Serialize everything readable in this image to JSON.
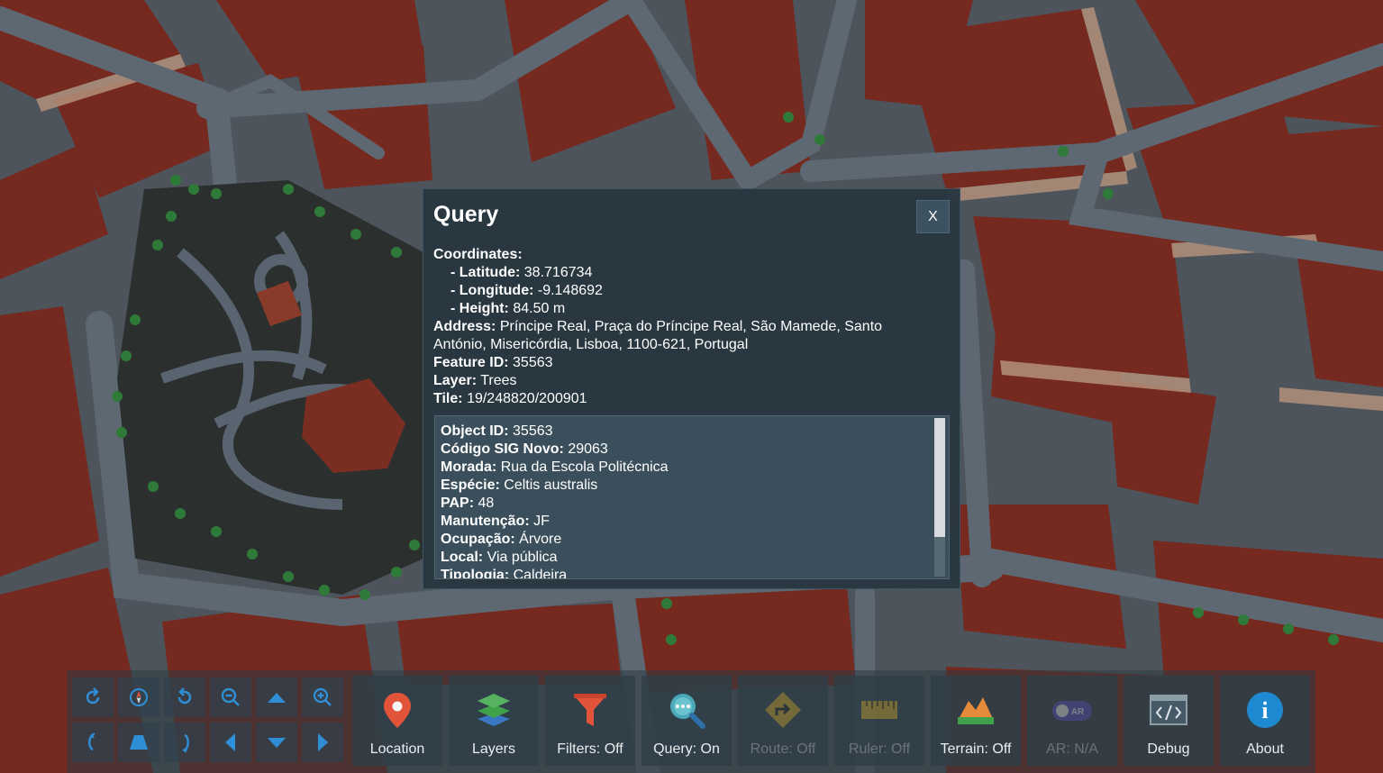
{
  "query": {
    "title": "Query",
    "close_label": "X",
    "coordinates_label": "Coordinates:",
    "latitude_label": "- Latitude:",
    "latitude": "38.716734",
    "longitude_label": "- Longitude:",
    "longitude": "-9.148692",
    "height_label": "- Height:",
    "height": "84.50 m",
    "address_label": "Address:",
    "address": "Príncipe Real, Praça do Príncipe Real, São Mamede, Santo António, Misericórdia, Lisboa, 1100-621, Portugal",
    "feature_id_label": "Feature ID:",
    "feature_id": "35563",
    "layer_label": "Layer:",
    "layer": "Trees",
    "tile_label": "Tile:",
    "tile": "19/248820/200901",
    "attributes": [
      {
        "key": "Object ID:",
        "value": "35563"
      },
      {
        "key": "Código SIG Novo:",
        "value": "29063"
      },
      {
        "key": "Morada:",
        "value": "Rua da Escola Politécnica"
      },
      {
        "key": "Espécie:",
        "value": "Celtis australis"
      },
      {
        "key": "PAP:",
        "value": "48"
      },
      {
        "key": "Manutenção:",
        "value": "JF"
      },
      {
        "key": "Ocupação:",
        "value": "Árvore"
      },
      {
        "key": "Local:",
        "value": "Via pública"
      },
      {
        "key": "Tipologia:",
        "value": "Caldeira"
      }
    ],
    "scroll_position": 0
  },
  "nav_controls": [
    {
      "name": "rotate-left-icon"
    },
    {
      "name": "compass-icon"
    },
    {
      "name": "rotate-right-icon"
    },
    {
      "name": "zoom-out-icon"
    },
    {
      "name": "pan-up-icon"
    },
    {
      "name": "zoom-in-icon"
    },
    {
      "name": "tilt-left-icon"
    },
    {
      "name": "tilt-up-icon"
    },
    {
      "name": "tilt-right-icon"
    },
    {
      "name": "pan-left-icon"
    },
    {
      "name": "pan-down-icon"
    },
    {
      "name": "pan-right-icon"
    }
  ],
  "tools": [
    {
      "label": "Location",
      "icon": "location-pin-icon",
      "enabled": true
    },
    {
      "label": "Layers",
      "icon": "layers-icon",
      "enabled": true
    },
    {
      "label": "Filters: Off",
      "icon": "filter-icon",
      "enabled": true
    },
    {
      "label": "Query: On",
      "icon": "query-magnifier-icon",
      "enabled": true
    },
    {
      "label": "Route: Off",
      "icon": "route-sign-icon",
      "enabled": false
    },
    {
      "label": "Ruler: Off",
      "icon": "ruler-icon",
      "enabled": false
    },
    {
      "label": "Terrain: Off",
      "icon": "terrain-icon",
      "enabled": true
    },
    {
      "label": "AR: N/A",
      "icon": "ar-toggle-icon",
      "enabled": false,
      "icon_text": "AR"
    },
    {
      "label": "Debug",
      "icon": "debug-code-icon",
      "enabled": true
    },
    {
      "label": "About",
      "icon": "info-icon",
      "enabled": true,
      "icon_text": "i"
    }
  ],
  "colors": {
    "roof": "#7a2e22",
    "roof_side": "#b8937a",
    "street": "#5c6772",
    "park": "#2a2e2e",
    "accent_red": "#e2543a",
    "accent_teal": "#4aa8b8",
    "accent_blue": "#1f8ad2"
  }
}
